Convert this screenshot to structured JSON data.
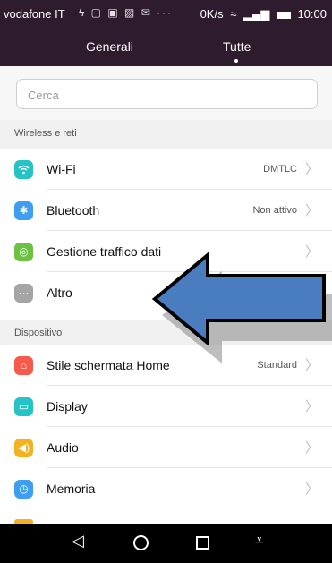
{
  "status_bar": {
    "carrier": "vodafone IT",
    "notification_icons": "ϟ ▢ ▣ ▨ ✉ ···",
    "speed": "0K/s",
    "time": "10:00"
  },
  "tabs": [
    {
      "label": "Generali"
    },
    {
      "label": "Tutte"
    }
  ],
  "search": {
    "placeholder": "Cerca",
    "value": ""
  },
  "sections": {
    "wireless": "Wireless e reti",
    "device": "Dispositivo"
  },
  "rows": [
    {
      "label": "Wi-Fi",
      "value": "DMTLC",
      "icon": "wifi-icon",
      "color": "#25c3c3"
    },
    {
      "label": "Bluetooth",
      "value": "Non attivo",
      "icon": "bluetooth-icon",
      "color": "#3e9ff2"
    },
    {
      "label": "Gestione traffico dati",
      "value": "",
      "icon": "data-traffic-icon",
      "color": "#6bc240"
    },
    {
      "label": "Altro",
      "value": "",
      "icon": "more-icon",
      "color": "#a5a5a5"
    },
    {
      "label": "Stile schermata Home",
      "value": "Standard",
      "icon": "home-style-icon",
      "color": "#f55a4a"
    },
    {
      "label": "Display",
      "value": "",
      "icon": "display-icon",
      "color": "#25c3c3"
    },
    {
      "label": "Audio",
      "value": "",
      "icon": "audio-icon",
      "color": "#f4b21f"
    },
    {
      "label": "Memoria",
      "value": "",
      "icon": "memory-icon",
      "color": "#3e9ff2"
    }
  ],
  "colors": {
    "header": "#2e1b2d",
    "annotation_arrow": "#4a7cc0"
  }
}
